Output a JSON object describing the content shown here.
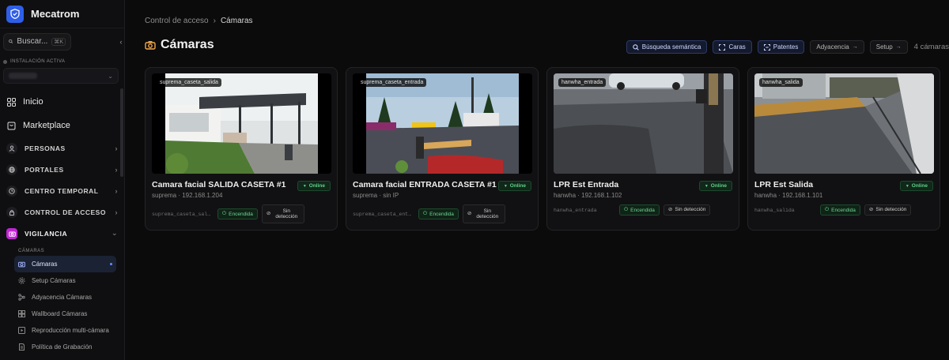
{
  "app": {
    "name": "Mecatrom"
  },
  "search": {
    "label": "Buscar...",
    "shortcut": "⌘K"
  },
  "installation": {
    "label": "INSTALACIÓN ACTIVA"
  },
  "nav": {
    "main": [
      {
        "label": "Inicio",
        "icon": "grid-icon"
      },
      {
        "label": "Marketplace",
        "icon": "store-icon"
      }
    ],
    "groups": [
      {
        "label": "PERSONAS",
        "icon": "users-icon"
      },
      {
        "label": "PORTALES",
        "icon": "globe-icon"
      },
      {
        "label": "CENTRO TEMPORAL",
        "icon": "clock-icon"
      },
      {
        "label": "CONTROL DE ACCESO",
        "icon": "lock-icon"
      },
      {
        "label": "VIGILANCIA",
        "icon": "camera-icon",
        "active": true
      }
    ],
    "section_label": "CÁMARAS",
    "sub_items": [
      {
        "label": "Cámaras",
        "active": true
      },
      {
        "label": "Setup Cámaras"
      },
      {
        "label": "Adyacencia Cámaras"
      },
      {
        "label": "Wallboard Cámaras"
      },
      {
        "label": "Reproducción multi-cámara"
      },
      {
        "label": "Política de Grabación"
      }
    ]
  },
  "breadcrumb": {
    "parent": "Control de acceso",
    "separator": "›",
    "current": "Cámaras"
  },
  "page": {
    "title": "Cámaras"
  },
  "toolbar": {
    "semantic_search": "Búsqueda semántica",
    "faces": "Caras",
    "plates": "Patentes",
    "adjacency": "Adyacencia",
    "setup": "Setup",
    "count": "4 cámaras"
  },
  "cameras": [
    {
      "tag": "suprema_caseta_salida",
      "title": "Camara facial SALIDA CASETA #1",
      "sub": "suprema · 192.168.1.204",
      "status": "Online",
      "id": "suprema_caseta_sal...",
      "power": "Encendida",
      "detection": "Sin detección"
    },
    {
      "tag": "suprema_caseta_entrada",
      "title": "Camara facial ENTRADA CASETA #1",
      "sub": "suprema · sin IP",
      "status": "Online",
      "id": "suprema_caseta_entr...",
      "power": "Encendida",
      "detection": "Sin detección"
    },
    {
      "tag": "hanwha_entrada",
      "title": "LPR Est Entrada",
      "sub": "hanwha · 192.168.1.102",
      "status": "Online",
      "id": "hanwha_entrada",
      "power": "Encendida",
      "detection": "Sin detección"
    },
    {
      "tag": "hanwha_salida",
      "title": "LPR Est Salida",
      "sub": "hanwha · 192.168.1.101",
      "status": "Online",
      "id": "hanwha_salida",
      "power": "Encendida",
      "detection": "Sin detección"
    }
  ],
  "colors": {
    "accent": "#2f5ee8",
    "vigilancia": "#c026d3",
    "online": "#5fd388"
  }
}
